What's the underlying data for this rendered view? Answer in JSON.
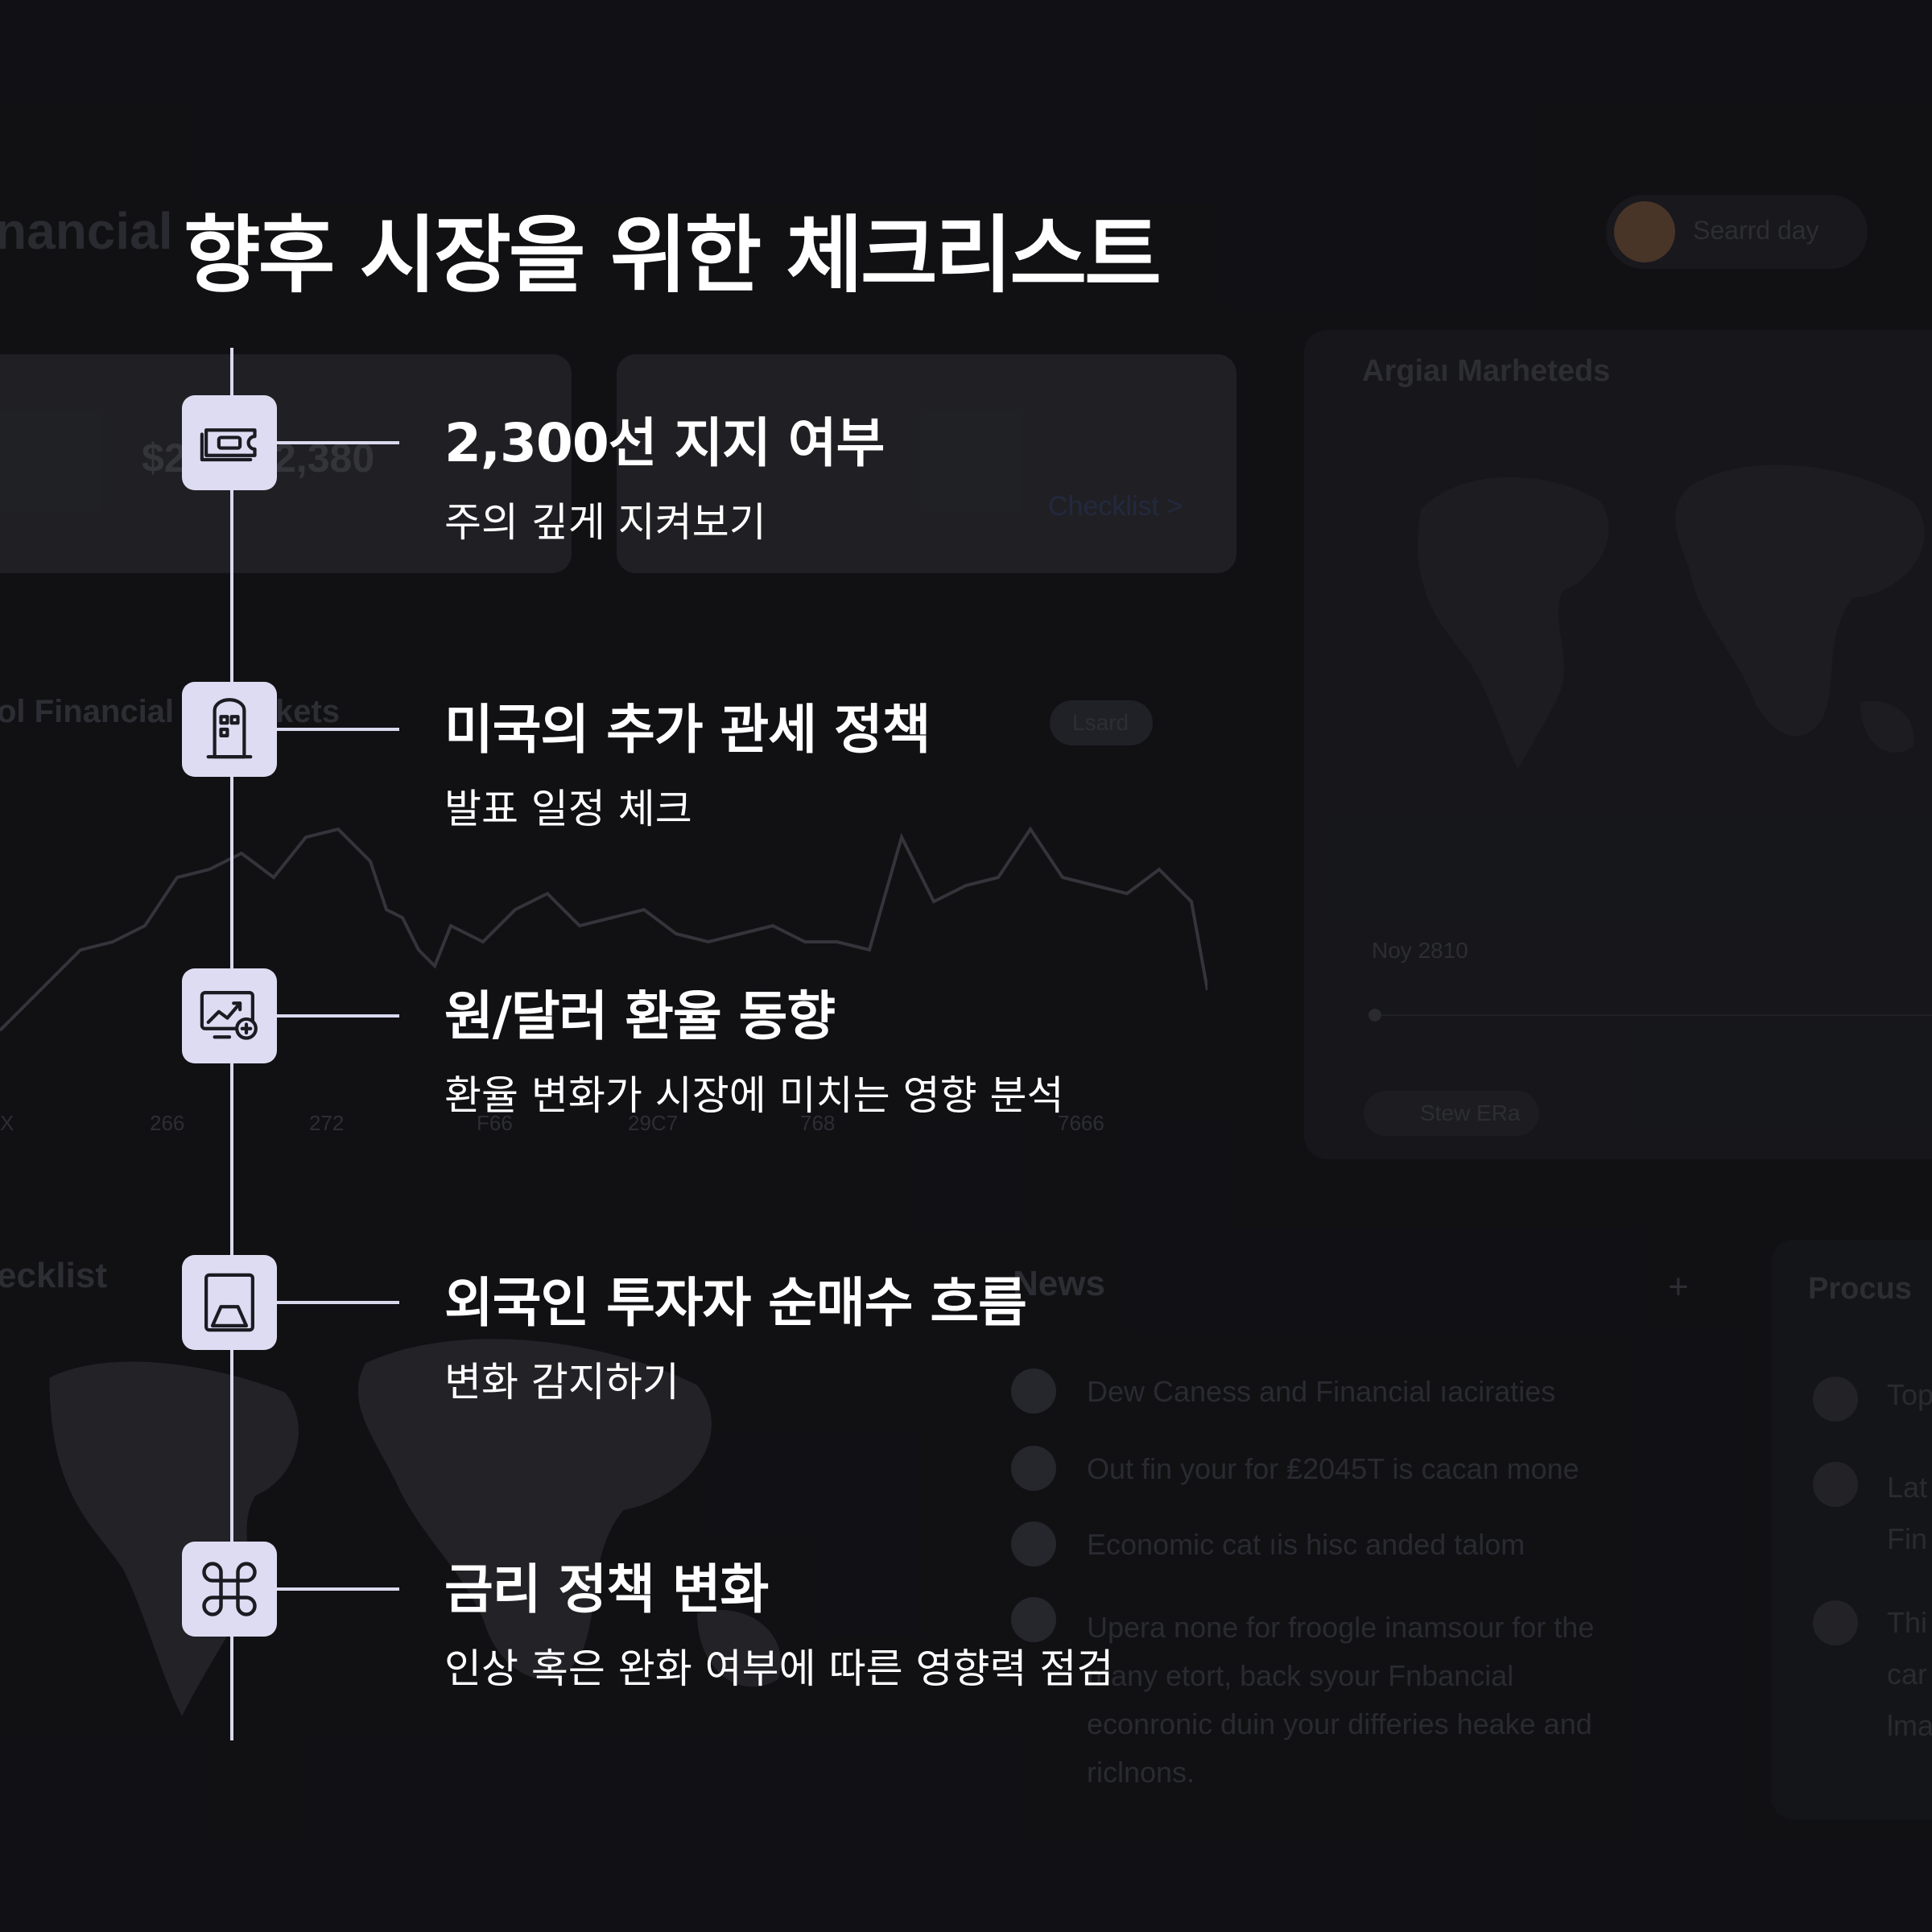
{
  "title": "향후 시장을 위한 체크리스트",
  "colors": {
    "background": "#141418",
    "icon_box": "#dddcf2",
    "timeline": "#d9d9ee",
    "text": "#ffffff"
  },
  "checklist": [
    {
      "icon": "ticket-icon",
      "title": "2,300선 지지 여부",
      "subtitle": "주의 깊게 지켜보기"
    },
    {
      "icon": "building-icon",
      "title": "미국의 추가 관세 정책",
      "subtitle": "발표 일정 체크"
    },
    {
      "icon": "exchange-chart-icon",
      "title": "원/달러 환율 동향",
      "subtitle": "환율 변화가 시장에 미치는 영향 분석"
    },
    {
      "icon": "flow-icon",
      "title": "외국인 투자자 순매수 흐름",
      "subtitle": "변화 감지하기"
    },
    {
      "icon": "command-icon",
      "title": "금리 정책 변화",
      "subtitle": "인상 혹은 완화 여부에 따른 영향력 점검"
    }
  ],
  "background_ui": {
    "header_fragment": "nancial",
    "search_button": "Searrd day",
    "card_value": "2,380",
    "card_value_prefix": "$2",
    "card_link": "Checklist >",
    "section_label": "ol Financial",
    "section_label_suffix": "kets",
    "map_title": "Argiaı Marheteds",
    "map_date": "Noy 2810",
    "map_button": "Stew ERa",
    "legend_button": "Lsard",
    "checklist_fragment": "ecklist",
    "news_title": "News",
    "news_add": "+",
    "side_title": "Procus",
    "news_items": [
      "Dew Caness and Financial ıaciraties",
      "Out fin your for ₤2045T is cacan mone",
      "Economic cat ıis hisc anded talom",
      "Upera none for froogle inamsour for the many etort, back syour Fnbancial econronic duin your differies heake and riclnons."
    ],
    "side_items": [
      "Top",
      "Lat Fin",
      "Thi car lma"
    ],
    "axis_ticks": [
      "X",
      "266",
      "272",
      "F66",
      "29C7",
      "768",
      "7666"
    ]
  }
}
